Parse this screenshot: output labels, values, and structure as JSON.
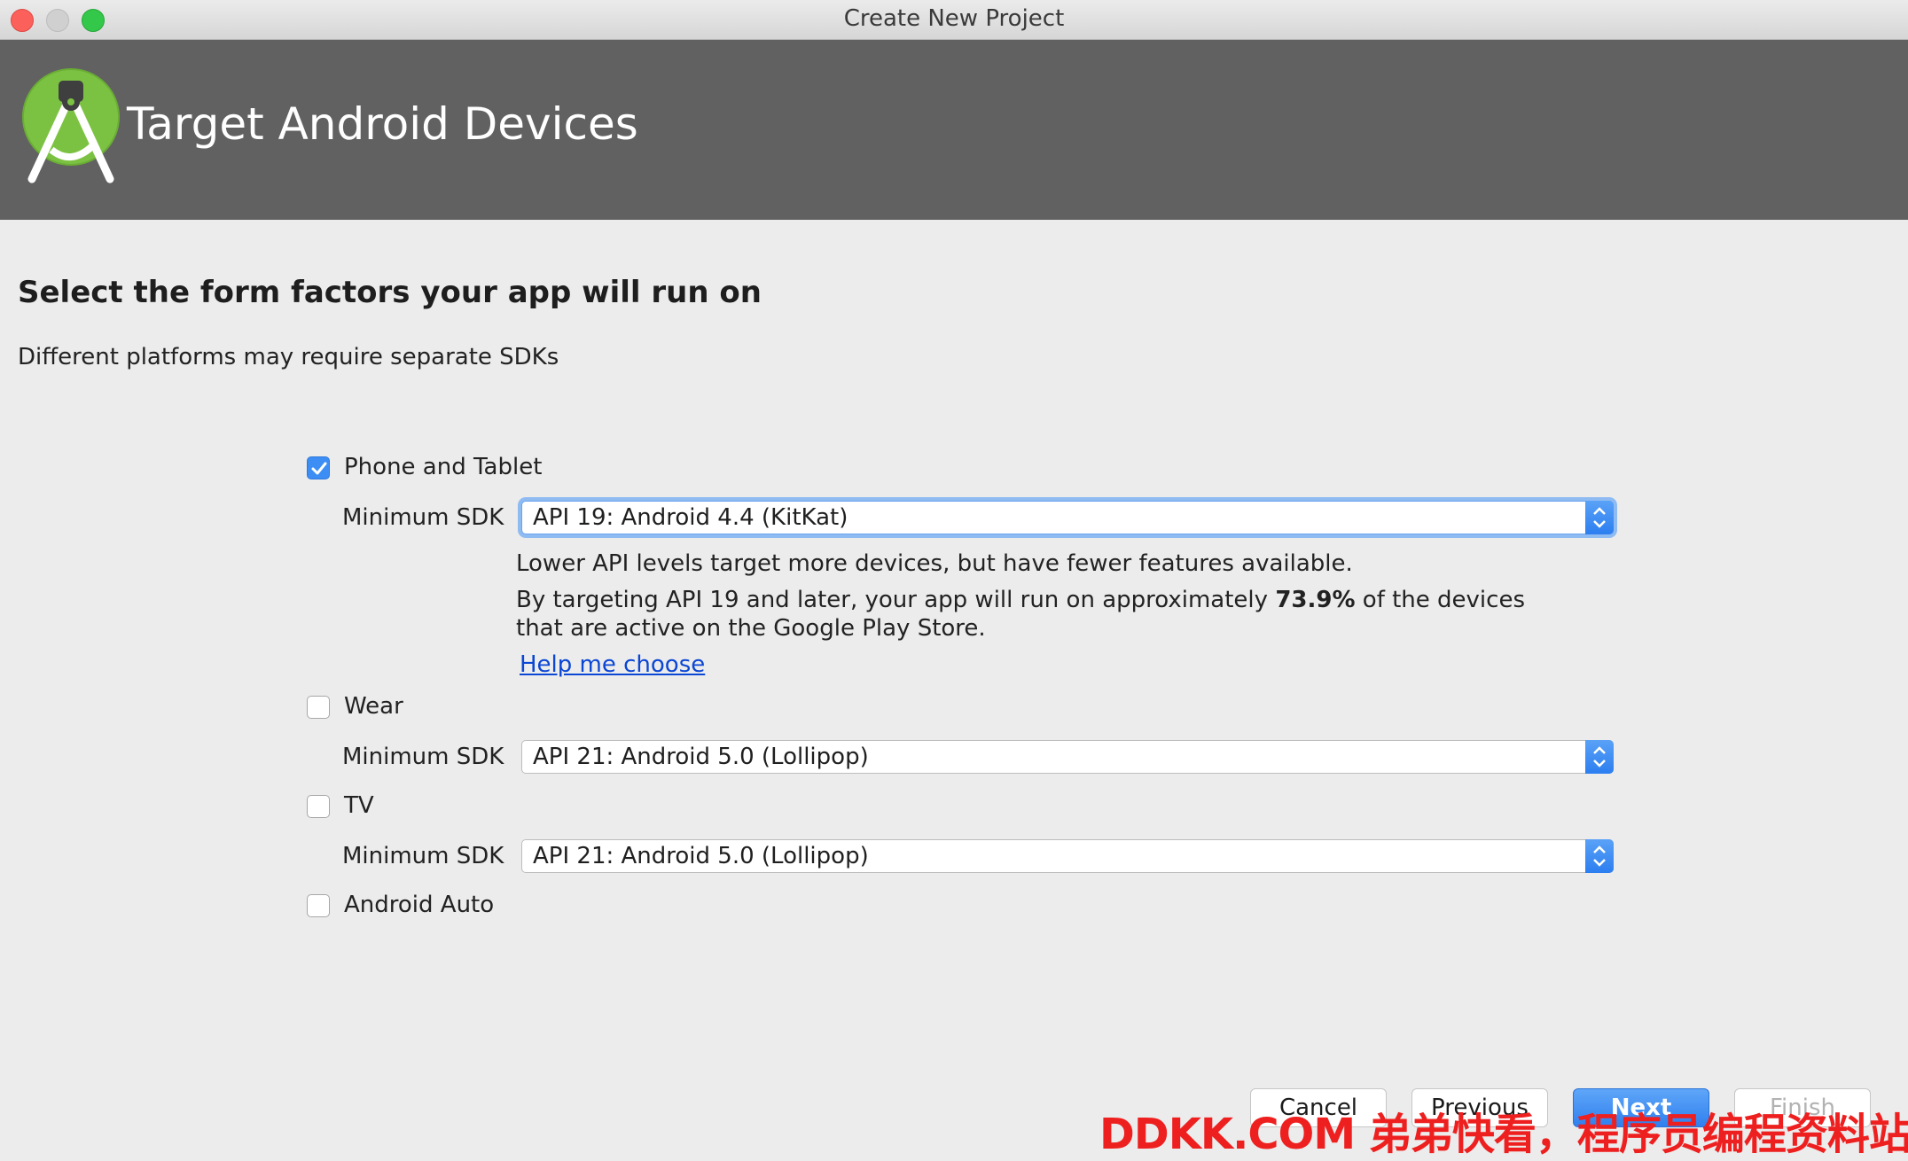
{
  "window": {
    "title": "Create New Project"
  },
  "banner": {
    "title": "Target Android Devices",
    "logo_icon": "android-studio-icon"
  },
  "page": {
    "heading": "Select the form factors your app will run on",
    "subheading": "Different platforms may require separate SDKs"
  },
  "form_factors": {
    "phone": {
      "label": "Phone and Tablet",
      "checked": true,
      "min_sdk_label": "Minimum SDK",
      "min_sdk_value": "API 19: Android 4.4 (KitKat)",
      "info_line1": "Lower API levels target more devices, but have fewer features available.",
      "info_line2_prefix": "By targeting API 19 and later, your app will run on approximately ",
      "info_line2_percent": "73.9%",
      "info_line2_suffix": " of the devices",
      "info_line3": "that are active on the Google Play Store.",
      "help_link": "Help me choose"
    },
    "wear": {
      "label": "Wear",
      "checked": false,
      "min_sdk_label": "Minimum SDK",
      "min_sdk_value": "API 21: Android 5.0 (Lollipop)"
    },
    "tv": {
      "label": "TV",
      "checked": false,
      "min_sdk_label": "Minimum SDK",
      "min_sdk_value": "API 21: Android 5.0 (Lollipop)"
    },
    "auto": {
      "label": "Android Auto",
      "checked": false
    }
  },
  "buttons": {
    "cancel": "Cancel",
    "previous": "Previous",
    "next": "Next",
    "finish": "Finish"
  },
  "watermark": "DDKK.COM 弟弟快看，程序员编程资料站",
  "colors": {
    "accent": "#3c8ef5",
    "banner": "#616161",
    "link": "#0b46d4",
    "watermark": "#ee1f1f"
  }
}
